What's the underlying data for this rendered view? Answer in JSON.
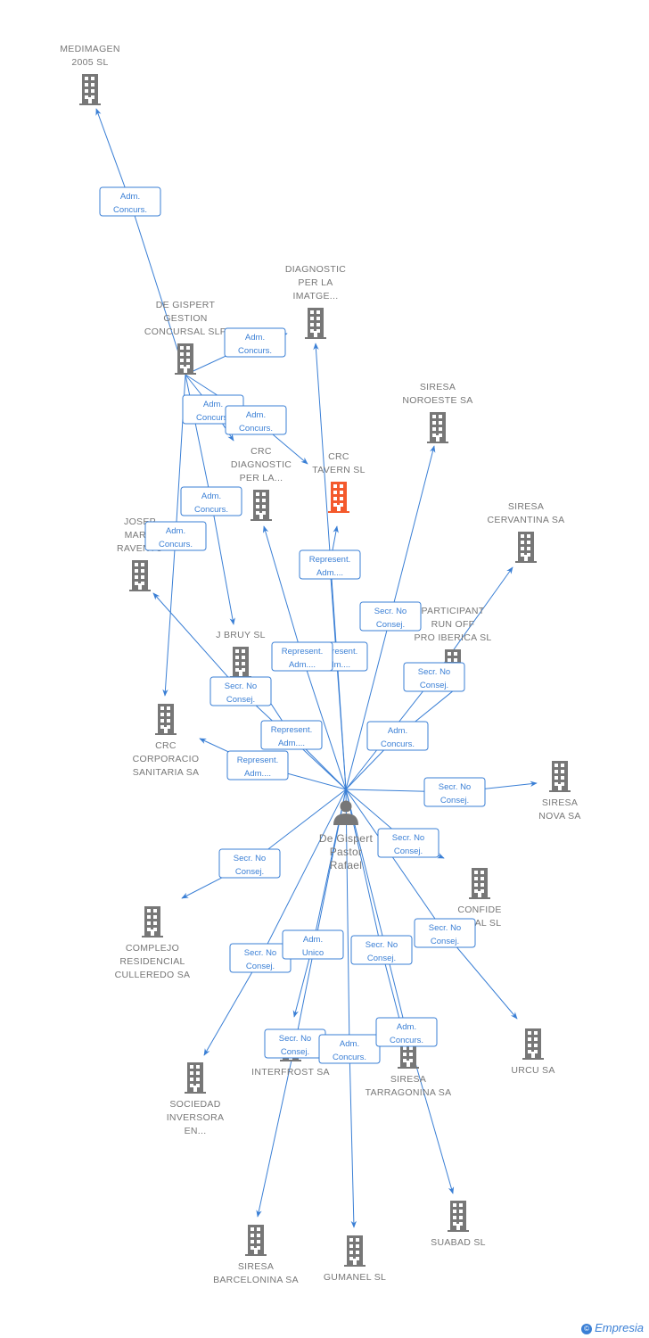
{
  "colors": {
    "edge": "#3a7fd5",
    "node": "#777777",
    "focus": "#f4592c"
  },
  "person": {
    "id": "person",
    "label": [
      "De Gispert",
      "Pastor",
      "Rafael"
    ],
    "icon": "person-icon"
  },
  "nodes": [
    {
      "id": "medimagen",
      "label": [
        "MEDIMAGEN",
        "2005 SL"
      ]
    },
    {
      "id": "gestion",
      "label": [
        "DE GISPERT",
        "GESTION",
        "CONCURSAL SLP"
      ]
    },
    {
      "id": "diagnostic",
      "label": [
        "DIAGNOSTIC",
        "PER LA",
        "IMATGE..."
      ]
    },
    {
      "id": "noroeste",
      "label": [
        "SIRESA",
        "NOROESTE SA"
      ]
    },
    {
      "id": "crcdiag",
      "label": [
        "CRC",
        "DIAGNOSTIC",
        "PER LA..."
      ]
    },
    {
      "id": "tavern",
      "label": [
        "CRC",
        "TAVERN SL"
      ],
      "focus": true
    },
    {
      "id": "cervantina",
      "label": [
        "SIRESA",
        "CERVANTINA SA"
      ]
    },
    {
      "id": "josep",
      "label": [
        "JOSEP",
        "MARIA",
        "RAVENTO"
      ]
    },
    {
      "id": "participant",
      "label": [
        "PARTICIPANT",
        "RUN OFF",
        "PRO IBERICA SL"
      ]
    },
    {
      "id": "jbruy",
      "label": [
        "J BRUY SL"
      ]
    },
    {
      "id": "corporacio",
      "label": [
        "CRC",
        "CORPORACIO",
        "SANITARIA SA"
      ]
    },
    {
      "id": "nova",
      "label": [
        "SIRESA",
        "NOVA SA"
      ]
    },
    {
      "id": "confide",
      "label": [
        "CONFIDE",
        "NCIAL SL"
      ]
    },
    {
      "id": "complejo",
      "label": [
        "COMPLEJO",
        "RESIDENCIAL",
        "CULLEREDO SA"
      ]
    },
    {
      "id": "urcu",
      "label": [
        "URCU SA"
      ]
    },
    {
      "id": "tarragonina",
      "label": [
        "SIRESA",
        "TARRAGONINA SA"
      ]
    },
    {
      "id": "interfrost",
      "label": [
        "INTERFROST SA"
      ]
    },
    {
      "id": "sociedad",
      "label": [
        "SOCIEDAD",
        "INVERSORA",
        "EN..."
      ]
    },
    {
      "id": "barcelonina",
      "label": [
        "SIRESA",
        "BARCELONINA SA"
      ]
    },
    {
      "id": "gumanel",
      "label": [
        "GUMANEL SL"
      ]
    },
    {
      "id": "suabad",
      "label": [
        "SUABAD SL"
      ]
    }
  ],
  "edges": [
    {
      "from": "gestion",
      "to": "medimagen",
      "label": [
        "Adm.",
        "Concurs."
      ]
    },
    {
      "from": "gestion",
      "to": "diagnostic",
      "label": [
        "Adm.",
        "Concurs."
      ]
    },
    {
      "from": "gestion",
      "to": "crcdiag",
      "label": [
        "Adm.",
        "Concurs."
      ]
    },
    {
      "from": "gestion",
      "to": "tavern",
      "label": [
        "Adm.",
        "Concurs."
      ]
    },
    {
      "from": "gestion",
      "to": "jbruy",
      "label": [
        "Adm.",
        "Concurs."
      ]
    },
    {
      "from": "gestion",
      "to": "corporacio",
      "label": [
        "Adm.",
        "Concurs."
      ]
    },
    {
      "from": "person",
      "to": "tavern",
      "label": [
        "Represent.",
        "Adm...."
      ]
    },
    {
      "from": "person",
      "to": "diagnostic",
      "label": [
        "Represent.",
        "Adm...."
      ]
    },
    {
      "from": "person",
      "to": "crcdiag",
      "label": [
        "Represent.",
        "Adm...."
      ]
    },
    {
      "from": "person",
      "to": "noroeste",
      "label": [
        "Secr.  No",
        "Consej."
      ]
    },
    {
      "from": "person",
      "to": "cervantina",
      "label": [
        "Secr.  No",
        "Consej."
      ]
    },
    {
      "from": "person",
      "to": "participant",
      "label": [
        "Adm.",
        "Concurs."
      ]
    },
    {
      "from": "person",
      "to": "josep",
      "label": [
        "Secr.  No",
        "Consej."
      ]
    },
    {
      "from": "person",
      "to": "jbruy",
      "label": [
        "Represent.",
        "Adm...."
      ]
    },
    {
      "from": "person",
      "to": "corporacio",
      "label": [
        "Represent.",
        "Adm...."
      ]
    },
    {
      "from": "person",
      "to": "nova",
      "label": [
        "Secr.  No",
        "Consej."
      ]
    },
    {
      "from": "person",
      "to": "confide",
      "label": [
        "Secr.  No",
        "Consej."
      ]
    },
    {
      "from": "person",
      "to": "complejo",
      "label": [
        "Secr.  No",
        "Consej."
      ]
    },
    {
      "from": "person",
      "to": "urcu",
      "label": [
        "Secr.  No",
        "Consej."
      ]
    },
    {
      "from": "person",
      "to": "sociedad",
      "label": [
        "Secr.  No",
        "Consej."
      ]
    },
    {
      "from": "person",
      "to": "interfrost",
      "label": [
        "Adm.",
        "Unico"
      ]
    },
    {
      "from": "person",
      "to": "tarragonina",
      "label": [
        "Secr.  No",
        "Consej."
      ]
    },
    {
      "from": "person",
      "to": "barcelonina",
      "label": [
        "Secr.  No",
        "Consej."
      ]
    },
    {
      "from": "person",
      "to": "gumanel",
      "label": [
        "Adm.",
        "Concurs."
      ]
    },
    {
      "from": "person",
      "to": "suabad",
      "label": [
        "Adm.",
        "Concurs."
      ]
    }
  ],
  "footer": {
    "logo": "Empresia",
    "copyright": "©"
  }
}
